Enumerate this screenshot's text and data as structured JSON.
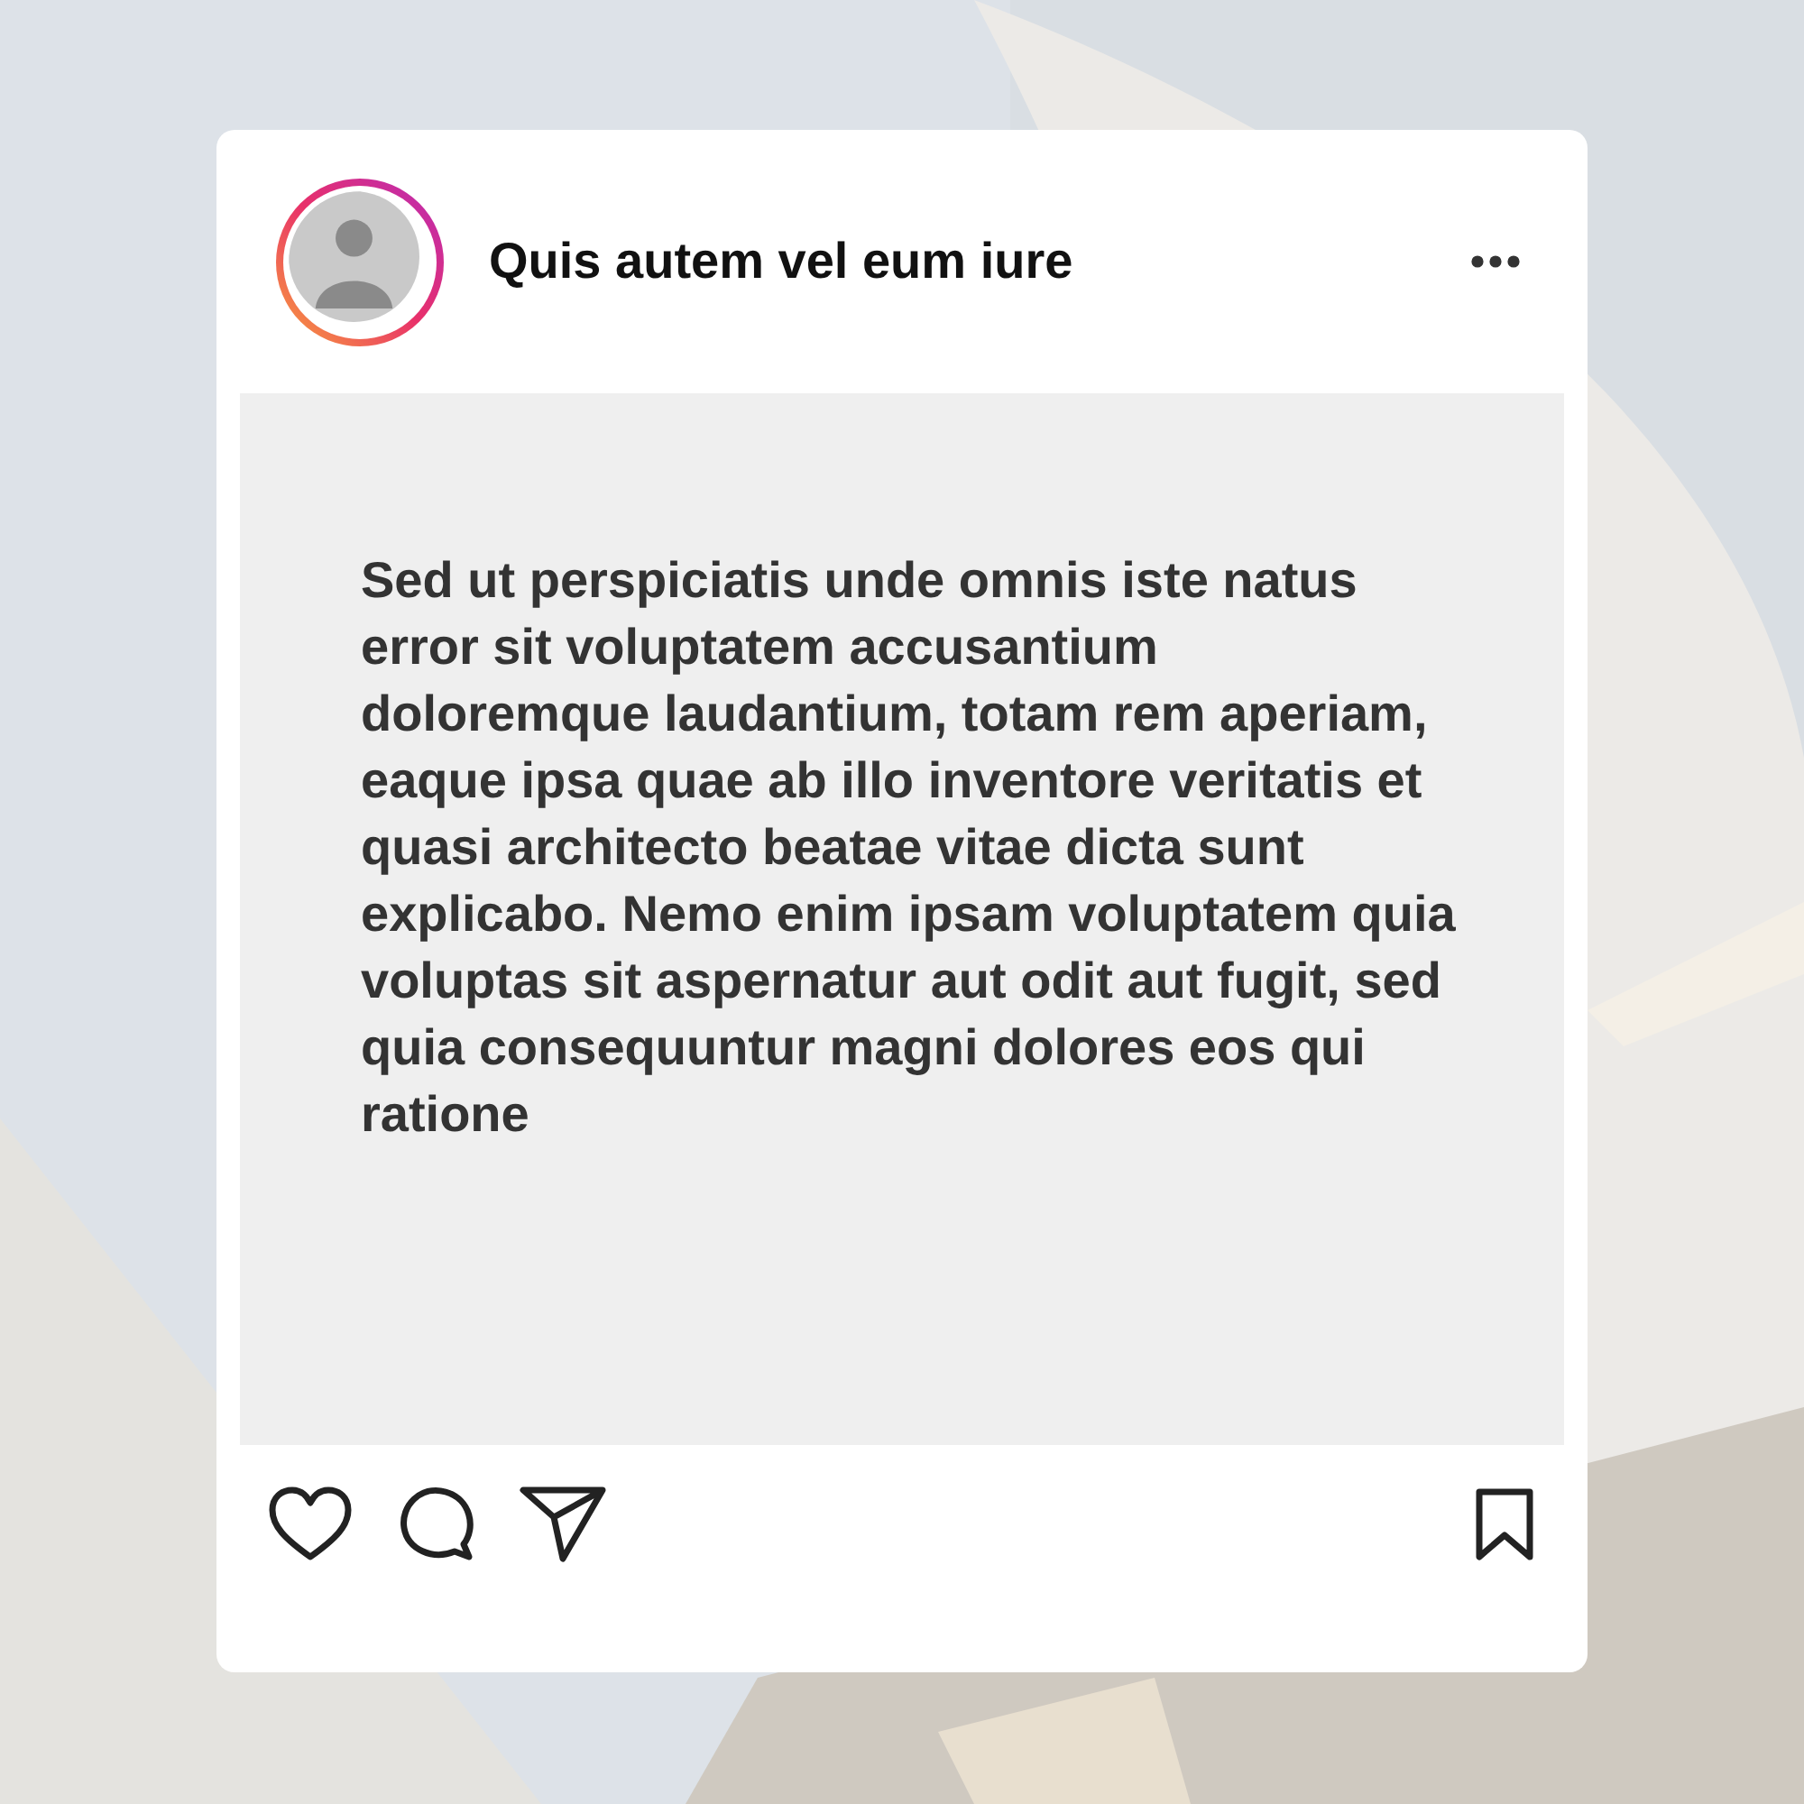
{
  "post": {
    "username": "Quis autem vel eum iure",
    "body": "Sed ut perspiciatis unde omnis iste natus error sit voluptatem accusantium doloremque laudantium, totam rem aperiam, eaque ipsa quae ab illo inventore veritatis et quasi architecto beatae vitae dicta sunt explicabo. Nemo enim ipsam voluptatem quia voluptas sit aspernatur aut odit aut fugit, sed quia consequuntur magni dolores eos qui ratione"
  }
}
